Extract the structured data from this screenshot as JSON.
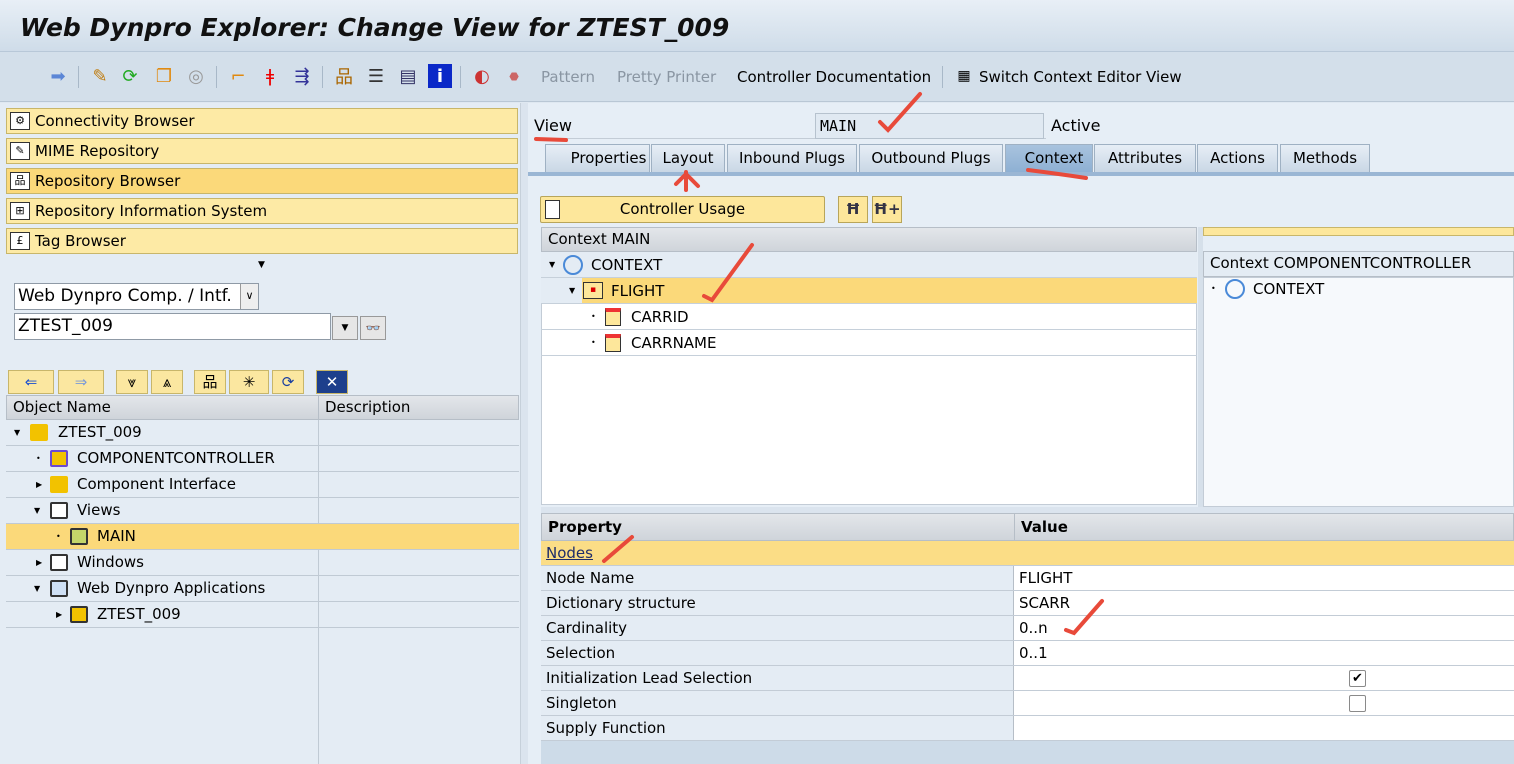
{
  "title": "Web Dynpro Explorer: Change View for ZTEST_009",
  "toolbar": {
    "pattern": "Pattern",
    "pretty_printer": "Pretty Printer",
    "controller_doc": "Controller Documentation",
    "switch_context": "Switch Context Editor View"
  },
  "nav": [
    "Connectivity Browser",
    "MIME Repository",
    "Repository Browser",
    "Repository Information System",
    "Tag Browser"
  ],
  "object_type": "Web Dynpro Comp. / Intf.",
  "object_name": "ZTEST_009",
  "tree": {
    "col_name": "Object Name",
    "col_desc": "Description",
    "rows": [
      "ZTEST_009",
      "COMPONENTCONTROLLER",
      "Component Interface",
      "Views",
      "MAIN",
      "Windows",
      "Web Dynpro Applications",
      "ZTEST_009"
    ]
  },
  "view": {
    "label": "View",
    "name": "MAIN",
    "status": "Active"
  },
  "tabs": [
    "Properties",
    "Layout",
    "Inbound Plugs",
    "Outbound Plugs",
    "Context",
    "Attributes",
    "Actions",
    "Methods"
  ],
  "controller_usage": "Controller Usage",
  "context_main": {
    "header": "Context MAIN",
    "nodes": [
      "CONTEXT",
      "FLIGHT",
      "CARRID",
      "CARRNAME"
    ]
  },
  "context_cc": {
    "header": "Context COMPONENTCONTROLLER",
    "nodes": [
      "CONTEXT"
    ]
  },
  "props": {
    "col_prop": "Property",
    "col_value": "Value",
    "section": "Nodes",
    "rows": [
      {
        "k": "Node Name",
        "v": "FLIGHT"
      },
      {
        "k": "Dictionary structure",
        "v": "SCARR"
      },
      {
        "k": "Cardinality",
        "v": "0..n"
      },
      {
        "k": "Selection",
        "v": "0..1"
      },
      {
        "k": "Initialization Lead Selection",
        "checked": true
      },
      {
        "k": "Singleton",
        "checked": false
      },
      {
        "k": "Supply Function",
        "v": ""
      }
    ]
  }
}
